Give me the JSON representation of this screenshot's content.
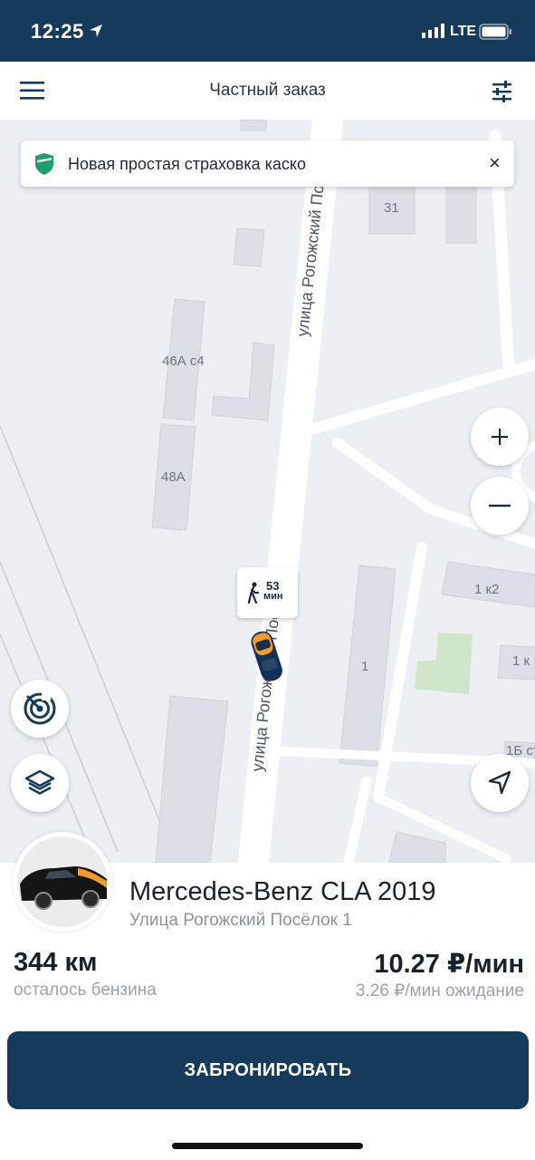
{
  "status_bar": {
    "time": "12:25",
    "network": "LTE"
  },
  "header": {
    "title": "Частный заказ"
  },
  "banner": {
    "text": "Новая простая страховка каско",
    "close": "×"
  },
  "map": {
    "street_label": "улица Рогожский Посёлок",
    "building_labels": [
      "31",
      "46А с4",
      "48А",
      "1 к2",
      "1",
      "1 к",
      "1Б ст"
    ]
  },
  "walk_time": {
    "value": "53",
    "unit": "мин"
  },
  "car": {
    "model": "Mercedes-Benz CLA 2019",
    "address": "Улица Рогожский Посёлок 1",
    "fuel": "344 км",
    "fuel_label": "осталось бензина",
    "price": "10.27 ₽/мин",
    "waiting_price": "3.26 ₽/мин ожидание"
  },
  "actions": {
    "book": "ЗАБРОНИРОВАТЬ"
  },
  "colors": {
    "primary": "#163a5b",
    "accent_orange": "#f29b2f",
    "shield_green": "#1e9e6a"
  }
}
